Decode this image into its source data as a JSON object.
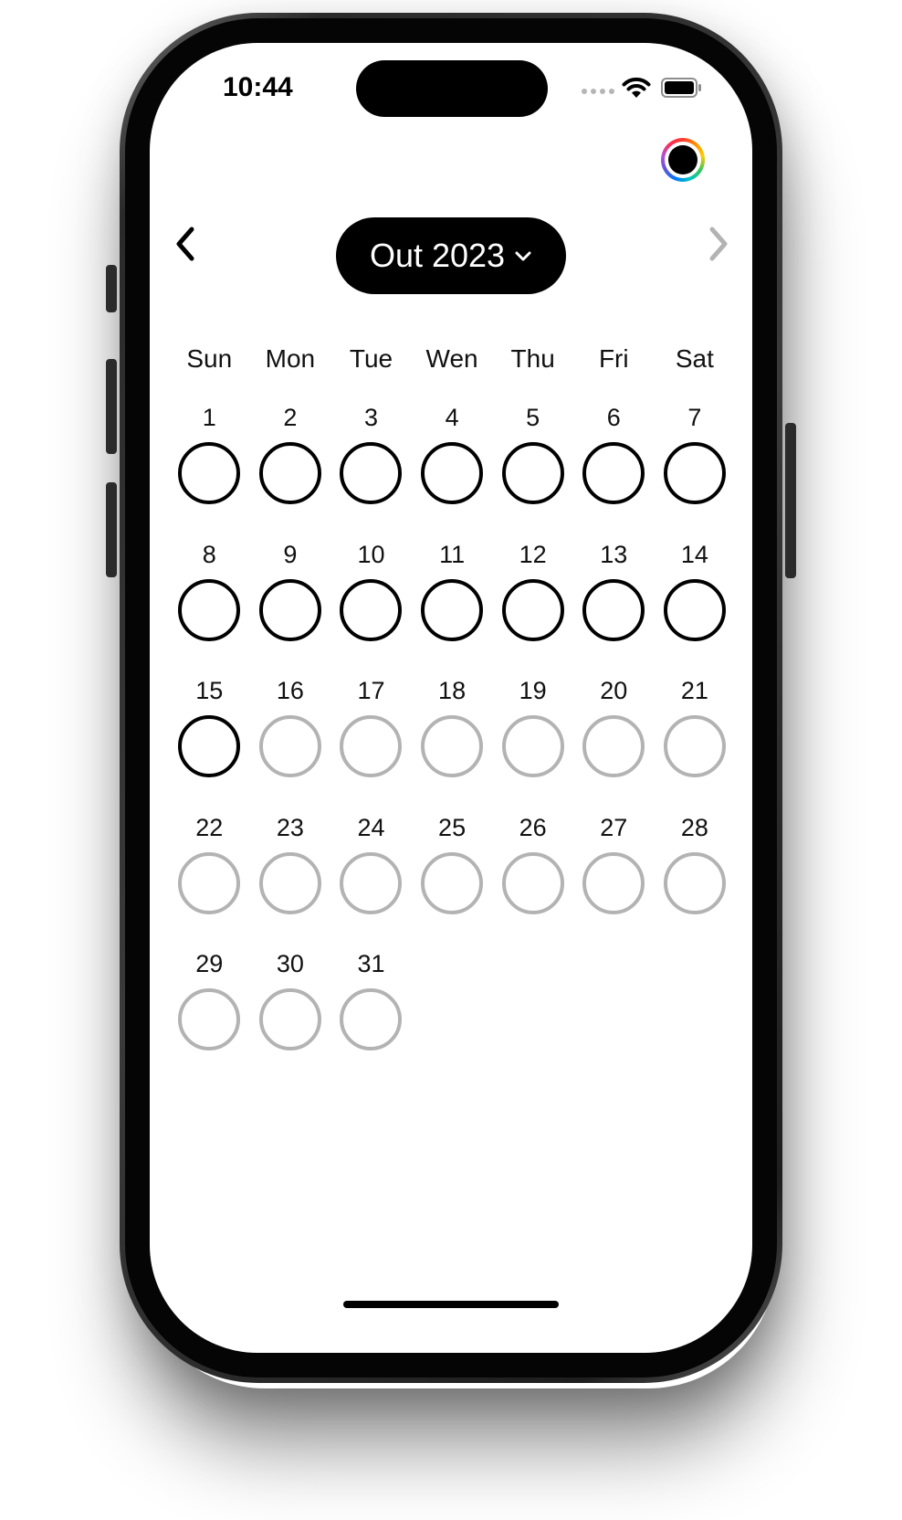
{
  "status_bar": {
    "time": "10:44",
    "icons": [
      "signal-dots-icon",
      "wifi-icon",
      "battery-icon"
    ]
  },
  "header": {
    "color_picker_icon": "color-wheel-icon",
    "prev_icon": "chevron-left-icon",
    "next_icon": "chevron-right-icon",
    "month_label": "Out 2023",
    "dropdown_icon": "chevron-down-icon"
  },
  "weekdays": [
    "Sun",
    "Mon",
    "Tue",
    "Wen",
    "Thu",
    "Fri",
    "Sat"
  ],
  "calendar": {
    "today": 15,
    "days": [
      "1",
      "2",
      "3",
      "4",
      "5",
      "6",
      "7",
      "8",
      "9",
      "10",
      "11",
      "12",
      "13",
      "14",
      "15",
      "16",
      "17",
      "18",
      "19",
      "20",
      "21",
      "22",
      "23",
      "24",
      "25",
      "26",
      "27",
      "28",
      "29",
      "30",
      "31"
    ]
  },
  "colors": {
    "active_ring": "#000000",
    "future_ring": "#b3b3b3",
    "pill_background": "#000000",
    "disabled_chevron": "#b3b3b3"
  }
}
